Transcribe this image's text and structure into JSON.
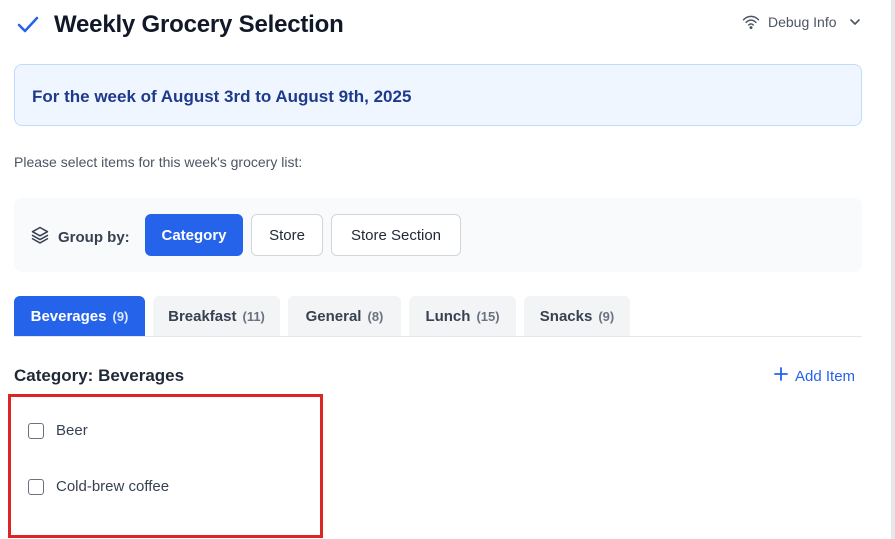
{
  "header": {
    "title": "Weekly Grocery Selection",
    "check_icon": "check-icon",
    "debug_label": "Debug Info",
    "debug_icon": "wifi-icon",
    "debug_chevron": "chevron-down-icon"
  },
  "banner": {
    "text": "For the week of August 3rd to August 9th, 2025"
  },
  "instructions": "Please select items for this week's grocery list:",
  "group_by": {
    "label": "Group by:",
    "icon": "layers-icon",
    "options": [
      {
        "label": "Category",
        "active": true
      },
      {
        "label": "Store",
        "active": false
      },
      {
        "label": "Store Section",
        "active": false
      }
    ]
  },
  "tabs": [
    {
      "label": "Beverages",
      "count": "(9)",
      "active": true
    },
    {
      "label": "Breakfast",
      "count": "(11)",
      "active": false
    },
    {
      "label": "General",
      "count": "(8)",
      "active": false
    },
    {
      "label": "Lunch",
      "count": "(15)",
      "active": false
    },
    {
      "label": "Snacks",
      "count": "(9)",
      "active": false
    }
  ],
  "category": {
    "heading": "Category: Beverages",
    "add_item_label": "Add Item",
    "add_icon": "plus-icon"
  },
  "items": [
    {
      "label": "Beer",
      "checked": false
    },
    {
      "label": "Cold-brew coffee",
      "checked": false
    }
  ],
  "colors": {
    "accent": "#2563eb",
    "banner_bg": "#eff6ff",
    "banner_text": "#1e3a8a",
    "highlight_box": "#dc2626"
  }
}
